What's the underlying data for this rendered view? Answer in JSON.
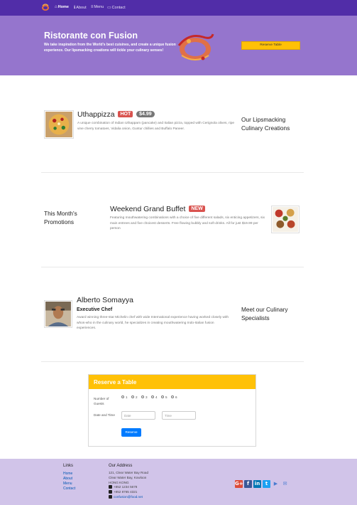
{
  "nav": {
    "items": [
      {
        "icon": "home-icon",
        "label": "Home"
      },
      {
        "icon": "info-icon",
        "label": "About"
      },
      {
        "icon": "list-icon",
        "label": "Menu"
      },
      {
        "icon": "address-card-icon",
        "label": "Contact"
      }
    ]
  },
  "jumbotron": {
    "title": "Ristorante con Fusion",
    "text": "We take inspiration from the World's best cuisines, and create a unique fusion experience. Our lipsmacking creations will tickle your culinary senses!",
    "reserve_button": "Reserve Table"
  },
  "dish": {
    "name": "Uthappizza",
    "badge": "HOT",
    "price": "$4.99",
    "description": "A unique combination of Indian Uthappam (pancake) and Italian pizza, topped with Cerignola olives, ripe vine cherry tomatoes, Vidalia onion, Guntur chillies and Buffalo Paneer.",
    "side_heading": "Our Lipsmacking Culinary Creations"
  },
  "promotion": {
    "side_heading": "This Month's Promotions",
    "name": "Weekend Grand Buffet",
    "badge": "NEW",
    "description": "Featuring mouthwatering combinations with a choice of five different salads, six enticing appetizers, six main entrees and five choicest desserts. Free flowing bubbly and soft drinks. All for just $19.99 per person"
  },
  "leader": {
    "name": "Alberto Somayya",
    "designation": "Executive Chef",
    "description": "Award winning three-star Michelin chef with wide International experience having worked closely with whos-who in the culinary world, he specializes in creating mouthwatering Indo-Italian fusion experiences.",
    "side_heading": "Meet our Culinary Specialists"
  },
  "reserve": {
    "title": "Reserve a Table",
    "guests_label": "Number of Guests",
    "guest_options": [
      "1",
      "2",
      "3",
      "4",
      "5",
      "6"
    ],
    "datetime_label": "Date and Time",
    "date_placeholder": "Date",
    "time_placeholder": "Time",
    "submit": "Reserve"
  },
  "footer": {
    "links_heading": "Links",
    "links": [
      "Home",
      "About",
      "Menu",
      "Contact"
    ],
    "address_heading": "Our Address",
    "address_lines": [
      "121, Clear Water Bay Road",
      "Clear Water Bay, Kowloon",
      "HONG KONG"
    ],
    "phone": "+852 1234 5678",
    "fax": "+852 8765 4321",
    "email": "confusion@food.net",
    "social": [
      {
        "icon": "google-plus-icon",
        "glyph": "G+",
        "color": "#dd4b39"
      },
      {
        "icon": "facebook-icon",
        "glyph": "f",
        "color": "#3b5998"
      },
      {
        "icon": "linkedin-icon",
        "glyph": "in",
        "color": "#0077b5"
      },
      {
        "icon": "twitter-icon",
        "glyph": "t",
        "color": "#1da1f2"
      },
      {
        "icon": "youtube-icon",
        "glyph": "▶",
        "color": "#4a7bd0"
      },
      {
        "icon": "mail-icon",
        "glyph": "✉",
        "color": "#4a7bd0"
      }
    ]
  }
}
